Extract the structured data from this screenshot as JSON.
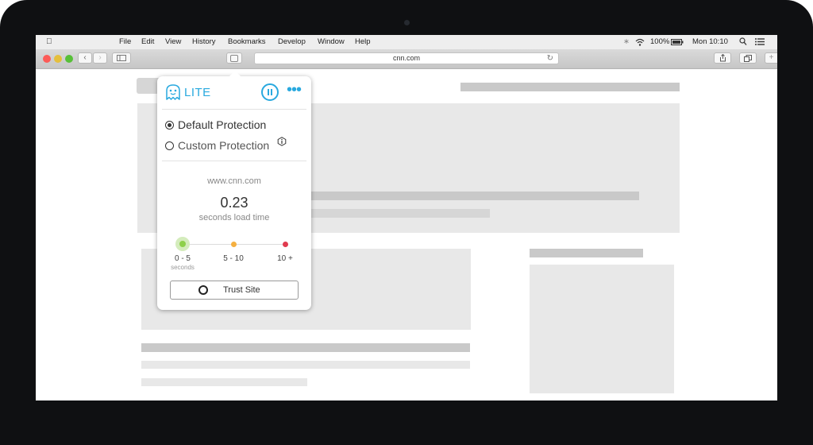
{
  "menubar": {
    "menus": [
      "File",
      "Edit",
      "View",
      "History",
      "Bookmarks",
      "Develop",
      "Window",
      "Help"
    ],
    "battery": "100%",
    "clock": "Mon 10:10"
  },
  "toolbar": {
    "url": "cnn.com"
  },
  "extension": {
    "brand": "LITE",
    "options": [
      "Default Protection",
      "Custom Protection"
    ],
    "selected_option": "Default Protection",
    "site": "www.cnn.com",
    "load_time": "0.23",
    "load_time_label": "seconds load time",
    "scale": [
      {
        "label": "0 - 5",
        "sub": "seconds",
        "color": "#8ed04b"
      },
      {
        "label": "5 - 10",
        "sub": "",
        "color": "#f5b041"
      },
      {
        "label": "10 +",
        "sub": "",
        "color": "#e03b4f"
      }
    ],
    "trust_button": "Trust Site"
  },
  "colors": {
    "accent": "#29a9df"
  }
}
